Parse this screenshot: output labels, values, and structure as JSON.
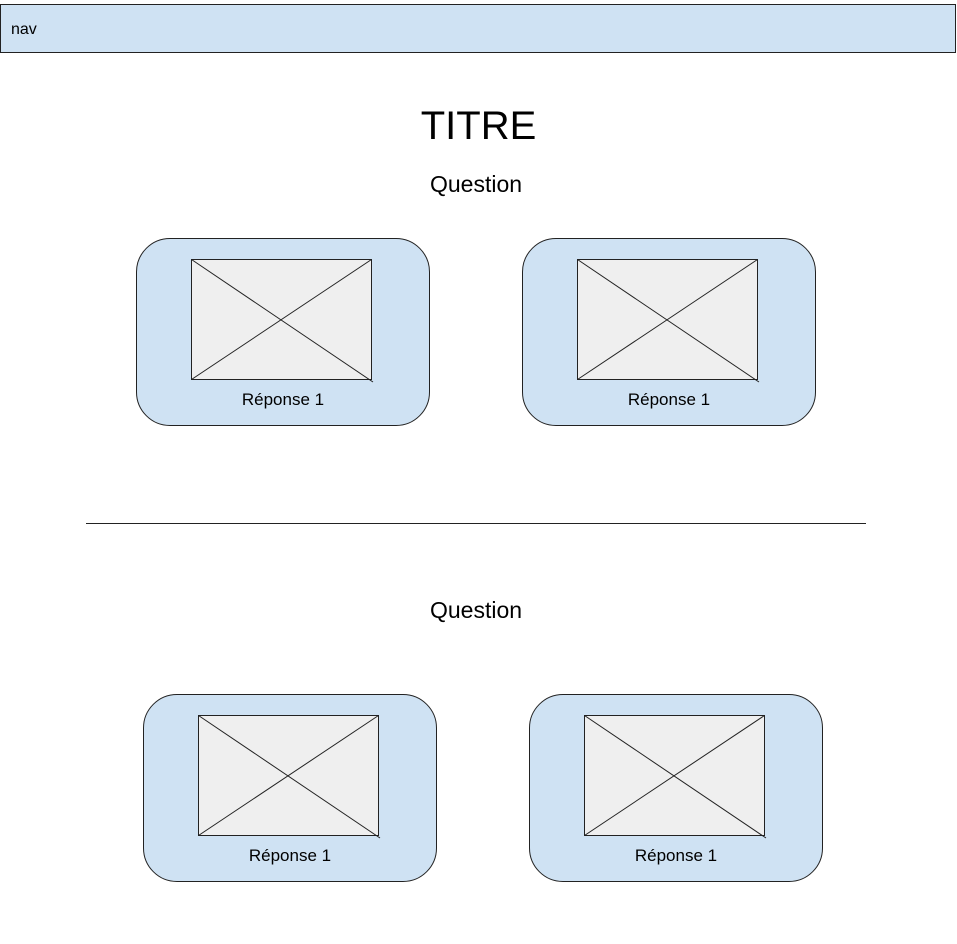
{
  "nav": {
    "label": "nav"
  },
  "title": "TITRE",
  "sections": [
    {
      "question": "Question",
      "answers": [
        {
          "label": "Réponse 1"
        },
        {
          "label": "Réponse 1"
        }
      ]
    },
    {
      "question": "Question",
      "answers": [
        {
          "label": "Réponse 1"
        },
        {
          "label": "Réponse 1"
        }
      ]
    }
  ],
  "colors": {
    "card_fill": "#cfe2f3",
    "image_placeholder_fill": "#efefef",
    "stroke": "#222222"
  }
}
